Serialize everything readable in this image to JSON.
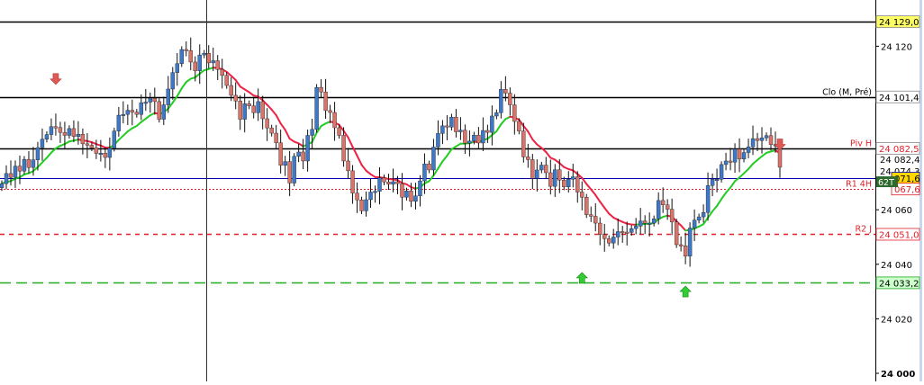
{
  "chart_data": {
    "type": "candlestick",
    "ylim": [
      24000,
      24132
    ],
    "price_scale_ticks": [
      {
        "value": 24120,
        "label": "24 120"
      },
      {
        "value": 24060,
        "label": "24 060"
      },
      {
        "value": 24040,
        "label": "24 040"
      },
      {
        "value": 24020,
        "label": "24 020"
      },
      {
        "value": 24000,
        "label": "24 000"
      }
    ],
    "horizontal_lines": [
      {
        "label": "",
        "price": 24129.0,
        "price_label": "24 129,0",
        "color": "#000000",
        "style": "solid",
        "badge_bg": "#ffff66"
      },
      {
        "label": "Clo (M, Pré)",
        "price": 24101.4,
        "price_label": "24 101,4",
        "color": "#000000",
        "style": "solid",
        "badge_bg": "#ffffff"
      },
      {
        "label": "Piv H",
        "price": 24082.5,
        "price_label": "24 082,5",
        "color": "#000000",
        "style": "solid",
        "badge_bg": "#ffffff",
        "text_color": "#e0202a"
      },
      {
        "label": "",
        "price": 24071.6,
        "price_label": "071,6",
        "color": "#0000aa",
        "style": "solid",
        "badge_bg": "#ffd700"
      },
      {
        "label": "R1 4H",
        "price": 24067.6,
        "price_label": "067,6",
        "color": "#e0202a",
        "style": "dotted",
        "badge_bg": "#ffffff",
        "text_color": "#e0202a"
      },
      {
        "label": "R2 J",
        "price": 24051.0,
        "price_label": "24 051,0",
        "color": "#e0202a",
        "style": "dashed",
        "badge_bg": "#ffffff",
        "text_color": "#e0202a"
      },
      {
        "label": "",
        "price": 24033.2,
        "price_label": "24 033,2",
        "color": "#22aa22",
        "style": "dashed",
        "badge_bg": "#ccffcc"
      }
    ],
    "extra_axis_labels": [
      {
        "price": 24101.4,
        "text": "24 101,4"
      },
      {
        "price": 24078.5,
        "text": "24 082,4"
      },
      {
        "price": 24074.3,
        "text": "24 074,3"
      }
    ],
    "timer_badge": "62T",
    "signals": [
      {
        "type": "sell",
        "bar": 12,
        "price": 24106
      },
      {
        "type": "sell",
        "bar": 190,
        "price": 24082
      },
      {
        "type": "buy",
        "bar": 129,
        "price": 24037
      },
      {
        "type": "buy",
        "bar": 152,
        "price": 24032
      }
    ],
    "moving_average_colors": {
      "up": "#22cc22",
      "down": "#ee2244"
    },
    "candle_colors": {
      "up": "#3e78c8",
      "down": "#d9746a"
    },
    "closes": [
      24069.6,
      24073.3,
      24071.9,
      24076.0,
      24074.2,
      24078.5,
      24075.5,
      24078.3,
      24082.8,
      24085.9,
      24087.6,
      24090.5,
      24090.2,
      24088.4,
      24087.3,
      24089.8,
      24086.9,
      24087.7,
      24084.2,
      24083.7,
      24082.7,
      24080.7,
      24080.8,
      24079.2,
      24082.6,
      24088.9,
      24094.7,
      24095.0,
      24096.5,
      24095.8,
      24095.0,
      24099.3,
      24099.5,
      24100.9,
      24099.7,
      24093.2,
      24098.5,
      24104.3,
      24110.3,
      24113.6,
      24118.8,
      24118.4,
      24114.2,
      24111.0,
      24116.8,
      24117.4,
      24113.9,
      24114.7,
      24111.5,
      24109.3,
      24105.6,
      24102.0,
      24099.9,
      24093.2,
      24098.9,
      24098.1,
      24095.6,
      24099.7,
      24093.4,
      24090.0,
      24088.1,
      24084.6,
      24076.3,
      24077.7,
      24069.8,
      24079.6,
      24081.2,
      24077.9,
      24087.3,
      24089.5,
      24104.9,
      24103.2,
      24096.4,
      24095.7,
      24090.1,
      24087.3,
      24077.9,
      24074.3,
      24066.1,
      24063.6,
      24059.6,
      24063.7,
      24066.5,
      24066.8,
      24071.7,
      24070.2,
      24069.4,
      24070.3,
      24069.6,
      24064.6,
      24066.9,
      24063.1,
      24065.1,
      24070.6,
      24076.8,
      24074.6,
      24083.0,
      24088.0,
      24090.8,
      24090.3,
      24094.0,
      24088.6,
      24089.2,
      24084.4,
      24085.2,
      24087.4,
      24084.5,
      24089.1,
      24088.4,
      24094.4,
      24095.6,
      24104.2,
      24102.8,
      24098.5,
      24092.4,
      24088.9,
      24079.4,
      24078.4,
      24071.5,
      24074.6,
      24076.4,
      24073.6,
      24068.6,
      24074.7,
      24070.9,
      24068.4,
      24071.2,
      24072.1,
      24066.5,
      24064.6,
      24058.2,
      24057.6,
      24055.1,
      24050.9,
      24049.4,
      24047.8,
      24050.0,
      24052.0,
      24051.8,
      24051.7,
      24053.1,
      24054.0,
      24055.9,
      24055.0,
      24055.1,
      24056.7,
      24063.4,
      24061.8,
      24060.2,
      24055.5,
      24047.2,
      24046.8,
      24043.0,
      24053.3,
      24056.2,
      24057.4,
      24059.0,
      24068.9,
      24071.2,
      24071.2,
      24076.6,
      24077.9,
      24077.5,
      24082.3,
      24078.6,
      24081.0,
      24083.1,
      24086.1,
      24085.4,
      24086.4,
      24087.2,
      24083.9,
      24083.9,
      24075.6
    ],
    "x_cursor": "vertical crosshair line"
  }
}
